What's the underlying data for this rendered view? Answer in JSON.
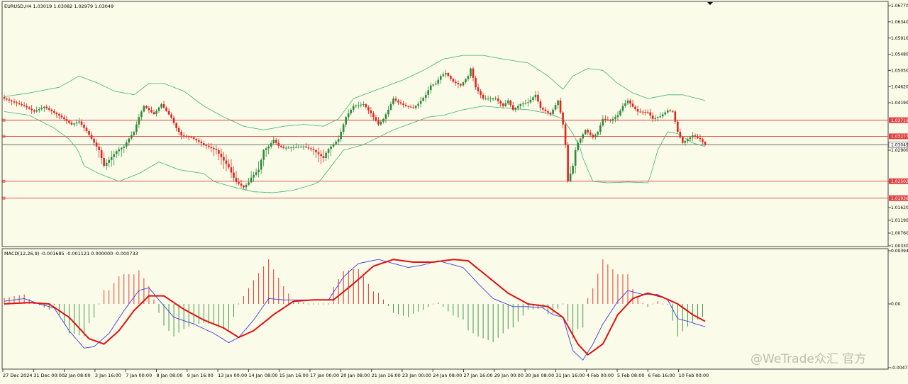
{
  "header": {
    "main_info": "EURUSD,H4  1.03019 1.03082 1.02979 1.03049",
    "macd_info": "MACD(12,26,9) -0.001685 -0.001121 0.000000 -0.000733"
  },
  "watermark": "@WeTrade众汇 官方",
  "colors": {
    "background": "#fbfbe9",
    "bull": "#2e8b3a",
    "bear": "#e3241b",
    "bands": "#3cb371",
    "level_lines": "#e04040",
    "macd_main": "#3a3ae0",
    "macd_signal": "#e01010"
  },
  "chart_data": [
    {
      "type": "candlestick",
      "symbol": "EURUSD",
      "timeframe": "H4",
      "last_ohlc": {
        "open": 1.03019,
        "high": 1.03082,
        "low": 1.02979,
        "close": 1.03049
      },
      "ylim": [
        1.0033,
        1.0677
      ],
      "y_ticks": [
        1.0677,
        1.0634,
        1.0591,
        1.0548,
        1.0505,
        1.0462,
        1.0419,
        1.029,
        1.025,
        1.0162,
        1.0119,
        1.0076,
        1.0033
      ],
      "y_tick_labels": [
        "1.06770",
        "1.06340",
        "1.05910",
        "1.05480",
        "1.05050",
        "1.04620",
        "1.04190",
        "1.02900",
        "1.02500",
        "1.01620",
        "1.01190",
        "1.00760",
        "1.00330"
      ],
      "price_levels": [
        1.03716,
        1.03277,
        1.02502,
        1.01936
      ],
      "price_level_labels": [
        "1.03716",
        "1.03277",
        "1.02502",
        "1.01936"
      ],
      "current_price": 1.03049,
      "current_price_label": "1.03049",
      "x_tick_labels": [
        "27 Dec 2024",
        "31 Dec 00:00",
        "2 Jan 08:00",
        "3 Jan 16:00",
        "7 Jan 00:00",
        "8 Jan 08:00",
        "9 Jan 16:00",
        "13 Jan 00:00",
        "14 Jan 08:00",
        "15 Jan 16:00",
        "17 Jan 00:00",
        "20 Jan 08:00",
        "21 Jan 16:00",
        "23 Jan 00:00",
        "24 Jan 08:00",
        "27 Jan 16:00",
        "29 Jan 00:00",
        "30 Jan 08:00",
        "31 Jan 16:00",
        "4 Feb 00:00",
        "5 Feb 08:00",
        "6 Feb 16:00",
        "10 Feb 00:00"
      ],
      "close_path": [
        [
          0,
          1.043
        ],
        [
          8,
          1.041
        ],
        [
          12,
          1.0395
        ],
        [
          16,
          1.0408
        ],
        [
          22,
          1.0384
        ],
        [
          27,
          1.036
        ],
        [
          30,
          1.0368
        ],
        [
          33,
          1.0342
        ],
        [
          37,
          1.03
        ],
        [
          40,
          1.027
        ],
        [
          44,
          1.0285
        ],
        [
          48,
          1.03
        ],
        [
          50,
          1.0322
        ],
        [
          52,
          1.034
        ],
        [
          54,
          1.038
        ],
        [
          56,
          1.041
        ],
        [
          60,
          1.0388
        ],
        [
          63,
          1.0415
        ],
        [
          67,
          1.0378
        ],
        [
          69,
          1.035
        ],
        [
          71,
          1.033
        ],
        [
          75,
          1.0325
        ],
        [
          80,
          1.0305
        ],
        [
          85,
          1.029
        ],
        [
          90,
          1.0268
        ],
        [
          93,
          1.0248
        ],
        [
          96,
          1.023
        ],
        [
          99,
          1.0255
        ],
        [
          102,
          1.0265
        ],
        [
          104,
          1.029
        ],
        [
          106,
          1.03
        ],
        [
          108,
          1.0318
        ],
        [
          110,
          1.0302
        ],
        [
          112,
          1.0296
        ],
        [
          116,
          1.0298
        ],
        [
          120,
          1.03
        ],
        [
          124,
          1.029
        ],
        [
          128,
          1.028
        ],
        [
          131,
          1.03
        ],
        [
          134,
          1.032
        ],
        [
          137,
          1.038
        ],
        [
          140,
          1.041
        ],
        [
          144,
          1.0415
        ],
        [
          147,
          1.039
        ],
        [
          150,
          1.036
        ],
        [
          152,
          1.0375
        ],
        [
          154,
          1.04
        ],
        [
          156,
          1.043
        ],
        [
          158,
          1.042
        ],
        [
          161,
          1.041
        ],
        [
          164,
          1.0405
        ],
        [
          166,
          1.0416
        ],
        [
          169,
          1.044
        ],
        [
          171,
          1.0465
        ],
        [
          173,
          1.047
        ],
        [
          175,
          1.049
        ],
        [
          177,
          1.0498
        ],
        [
          180,
          1.0475
        ],
        [
          183,
          1.0465
        ],
        [
          186,
          1.049
        ],
        [
          187,
          1.051
        ],
        [
          189,
          1.046
        ],
        [
          192,
          1.043
        ],
        [
          197,
          1.043
        ],
        [
          200,
          1.041
        ],
        [
          202,
          1.0425
        ],
        [
          204,
          1.04
        ],
        [
          207,
          1.0415
        ],
        [
          210,
          1.042
        ],
        [
          213,
          1.044
        ],
        [
          215,
          1.0405
        ],
        [
          217,
          1.0396
        ],
        [
          219,
          1.0388
        ],
        [
          222,
          1.0425
        ],
        [
          224,
          1.036
        ],
        [
          226,
          1.025
        ],
        [
          228,
          1.027
        ],
        [
          230,
          1.031
        ],
        [
          233,
          1.0345
        ],
        [
          236,
          1.0325
        ],
        [
          238,
          1.034
        ],
        [
          240,
          1.0375
        ],
        [
          243,
          1.037
        ],
        [
          246,
          1.0385
        ],
        [
          248,
          1.041
        ],
        [
          250,
          1.0425
        ],
        [
          252,
          1.0408
        ],
        [
          254,
          1.0395
        ],
        [
          258,
          1.0393
        ],
        [
          260,
          1.0375
        ],
        [
          263,
          1.0382
        ],
        [
          266,
          1.0398
        ],
        [
          268,
          1.0395
        ],
        [
          270,
          1.034
        ],
        [
          272,
          1.031
        ],
        [
          274,
          1.032
        ],
        [
          276,
          1.033
        ],
        [
          279,
          1.032
        ],
        [
          281,
          1.0305
        ]
      ],
      "bollinger_upper_path": [
        [
          0,
          1.0435
        ],
        [
          10,
          1.0445
        ],
        [
          22,
          1.046
        ],
        [
          30,
          1.049
        ],
        [
          38,
          1.047
        ],
        [
          44,
          1.045
        ],
        [
          52,
          1.044
        ],
        [
          58,
          1.047
        ],
        [
          64,
          1.047
        ],
        [
          72,
          1.045
        ],
        [
          80,
          1.041
        ],
        [
          88,
          1.038
        ],
        [
          96,
          1.0355
        ],
        [
          104,
          1.0345
        ],
        [
          112,
          1.0355
        ],
        [
          120,
          1.036
        ],
        [
          128,
          1.0355
        ],
        [
          134,
          1.0375
        ],
        [
          140,
          1.043
        ],
        [
          148,
          1.045
        ],
        [
          154,
          1.0465
        ],
        [
          160,
          1.048
        ],
        [
          168,
          1.0505
        ],
        [
          176,
          1.0535
        ],
        [
          184,
          1.0545
        ],
        [
          192,
          1.0545
        ],
        [
          200,
          1.0535
        ],
        [
          210,
          1.0525
        ],
        [
          218,
          1.049
        ],
        [
          224,
          1.0455
        ],
        [
          228,
          1.049
        ],
        [
          234,
          1.051
        ],
        [
          240,
          1.0505
        ],
        [
          246,
          1.047
        ],
        [
          252,
          1.0445
        ],
        [
          258,
          1.043
        ],
        [
          266,
          1.044
        ],
        [
          272,
          1.044
        ],
        [
          281,
          1.0425
        ]
      ],
      "bollinger_lower_path": [
        [
          0,
          1.0395
        ],
        [
          10,
          1.0385
        ],
        [
          20,
          1.035
        ],
        [
          26,
          1.032
        ],
        [
          32,
          1.027
        ],
        [
          38,
          1.026
        ],
        [
          46,
          1.025
        ],
        [
          54,
          1.026
        ],
        [
          62,
          1.0275
        ],
        [
          70,
          1.0265
        ],
        [
          80,
          1.026
        ],
        [
          90,
          1.0235
        ],
        [
          100,
          1.0215
        ],
        [
          108,
          1.0212
        ],
        [
          116,
          1.022
        ],
        [
          124,
          1.024
        ],
        [
          130,
          1.0265
        ],
        [
          136,
          1.029
        ],
        [
          144,
          1.0305
        ],
        [
          150,
          1.0325
        ],
        [
          156,
          1.0345
        ],
        [
          162,
          1.036
        ],
        [
          166,
          1.037
        ],
        [
          170,
          1.038
        ],
        [
          176,
          1.0385
        ],
        [
          184,
          1.04
        ],
        [
          192,
          1.041
        ],
        [
          200,
          1.0405
        ],
        [
          210,
          1.04
        ],
        [
          218,
          1.039
        ],
        [
          224,
          1.0375
        ],
        [
          228,
          1.0335
        ],
        [
          232,
          1.028
        ],
        [
          236,
          1.025
        ],
        [
          242,
          1.0245
        ],
        [
          250,
          1.0248
        ],
        [
          258,
          1.0245
        ],
        [
          262,
          1.029
        ],
        [
          266,
          1.034
        ],
        [
          270,
          1.0335
        ],
        [
          276,
          1.031
        ],
        [
          281,
          1.03
        ]
      ]
    },
    {
      "type": "macd",
      "params": "MACD(12,26,9)",
      "values": {
        "main": -0.001685,
        "signal": -0.001121,
        "zero": 0.0,
        "histogram": -0.000733
      },
      "ylim": [
        -0.00477,
        0.00394
      ],
      "y_tick_labels": [
        "0.00394",
        "0.00",
        "-0.00477"
      ],
      "main_path": [
        [
          0,
          0.0002
        ],
        [
          8,
          0.0004
        ],
        [
          14,
          0.0
        ],
        [
          20,
          -0.0003
        ],
        [
          26,
          -0.002
        ],
        [
          32,
          -0.0033
        ],
        [
          36,
          -0.0032
        ],
        [
          42,
          -0.0022
        ],
        [
          48,
          -0.0005
        ],
        [
          54,
          0.001
        ],
        [
          58,
          0.0012
        ],
        [
          62,
          0.0003
        ],
        [
          68,
          -0.001
        ],
        [
          76,
          -0.0015
        ],
        [
          84,
          -0.0022
        ],
        [
          90,
          -0.0029
        ],
        [
          94,
          -0.0025
        ],
        [
          100,
          -0.0012
        ],
        [
          106,
          0.0004
        ],
        [
          112,
          0.0003
        ],
        [
          118,
          0.0003
        ],
        [
          124,
          0.0003
        ],
        [
          130,
          0.0003
        ],
        [
          136,
          0.002
        ],
        [
          142,
          0.003
        ],
        [
          150,
          0.0033
        ],
        [
          156,
          0.003
        ],
        [
          162,
          0.0027
        ],
        [
          168,
          0.0029
        ],
        [
          174,
          0.0032
        ],
        [
          178,
          0.003
        ],
        [
          184,
          0.0027
        ],
        [
          190,
          0.0015
        ],
        [
          196,
          0.0004
        ],
        [
          204,
          -0.0002
        ],
        [
          210,
          -0.0002
        ],
        [
          216,
          -0.0003
        ],
        [
          220,
          -0.0008
        ],
        [
          224,
          -0.001
        ],
        [
          228,
          -0.0035
        ],
        [
          232,
          -0.0042
        ],
        [
          236,
          -0.003
        ],
        [
          240,
          -0.0015
        ],
        [
          246,
          0.0002
        ],
        [
          250,
          0.001
        ],
        [
          256,
          0.0007
        ],
        [
          262,
          0.0007
        ],
        [
          266,
          0.0003
        ],
        [
          270,
          -0.0011
        ],
        [
          274,
          -0.0013
        ],
        [
          281,
          -0.0017
        ]
      ],
      "signal_path": [
        [
          0,
          0.0
        ],
        [
          10,
          0.0001
        ],
        [
          18,
          0.0
        ],
        [
          26,
          -0.001
        ],
        [
          34,
          -0.0026
        ],
        [
          40,
          -0.003
        ],
        [
          46,
          -0.002
        ],
        [
          52,
          -0.0005
        ],
        [
          58,
          0.0006
        ],
        [
          64,
          0.0006
        ],
        [
          72,
          -0.0004
        ],
        [
          80,
          -0.0012
        ],
        [
          88,
          -0.0018
        ],
        [
          94,
          -0.0025
        ],
        [
          100,
          -0.002
        ],
        [
          108,
          -0.0008
        ],
        [
          116,
          0.0002
        ],
        [
          124,
          0.0003
        ],
        [
          132,
          0.0003
        ],
        [
          140,
          0.0015
        ],
        [
          148,
          0.0028
        ],
        [
          156,
          0.0033
        ],
        [
          164,
          0.0031
        ],
        [
          172,
          0.0031
        ],
        [
          180,
          0.0033
        ],
        [
          186,
          0.0032
        ],
        [
          194,
          0.002
        ],
        [
          202,
          0.0008
        ],
        [
          210,
          0.0
        ],
        [
          218,
          -0.0002
        ],
        [
          224,
          -0.001
        ],
        [
          230,
          -0.003
        ],
        [
          234,
          -0.0038
        ],
        [
          240,
          -0.003
        ],
        [
          246,
          -0.0008
        ],
        [
          252,
          0.0004
        ],
        [
          258,
          0.0008
        ],
        [
          264,
          0.0005
        ],
        [
          270,
          0.0
        ],
        [
          276,
          -0.0008
        ],
        [
          281,
          -0.0013
        ]
      ]
    }
  ]
}
